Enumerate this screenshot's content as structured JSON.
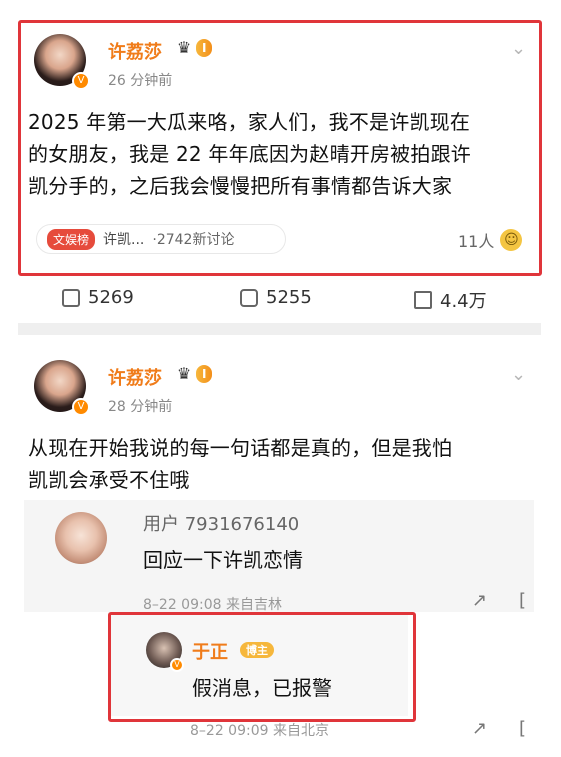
{
  "post1": {
    "author": "许荔莎",
    "time": "26 分钟前",
    "text_line1": "2025 年第一大瓜来咯，家人们，我不是许凯现在",
    "text_line2": "的女朋友，我是 22 年年底因为赵晴开房被拍跟许",
    "text_line3": "凯分手的，之后我会慢慢把所有事情都告诉大家",
    "topic_tag": "文娱榜",
    "topic_name": "许凯...",
    "topic_count": "·2742新讨论",
    "people_count": "11人"
  },
  "actions": {
    "repost": "5269",
    "comment": "5255",
    "like": "4.4万"
  },
  "post2": {
    "author": "许荔莎",
    "time": "28 分钟前",
    "text_line1": "从现在开始我说的每一句话都是真的，但是我怕",
    "text_line2": "凯凯会承受不住哦",
    "comment": {
      "username": "用户 7931676140",
      "text": "回应一下许凯恋情",
      "meta": "8–22 09:08 来自吉林"
    },
    "reply": {
      "username": "于正",
      "badge": "博主",
      "text": "假消息，已报警",
      "meta": "8–22 09:09 来自北京"
    }
  },
  "icons": {
    "chevron": "chevron-down-icon",
    "crown": "crown-icon",
    "verified": "verified-icon",
    "repost": "repost-icon",
    "comment": "comment-icon",
    "like": "like-icon",
    "share": "share-icon",
    "emoji": "emoji-icon"
  },
  "colors": {
    "name_orange": "#f07c1a",
    "highlight_red": "#e0353a",
    "badge_gold": "#f6b73c"
  },
  "badges": {
    "level": "I"
  }
}
